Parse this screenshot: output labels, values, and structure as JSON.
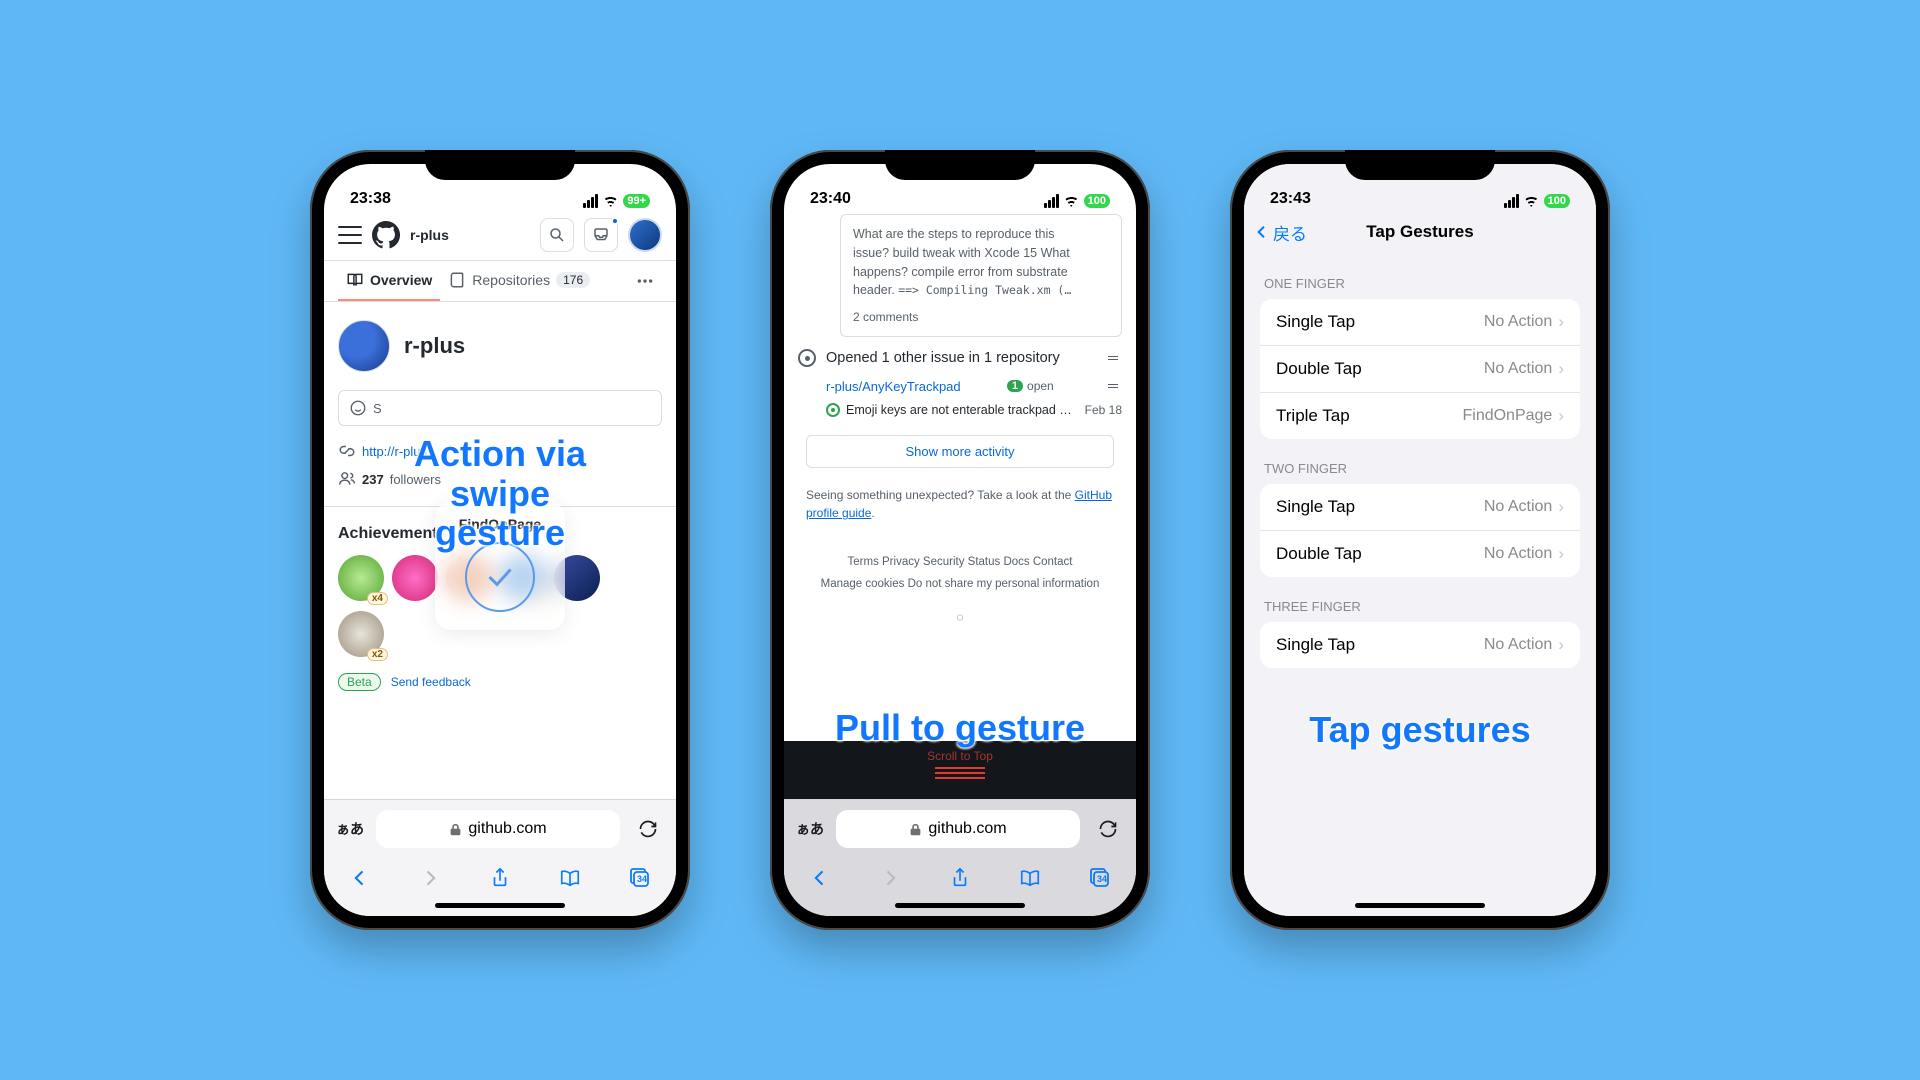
{
  "phone1": {
    "status": {
      "time": "23:38",
      "battery": "99+"
    },
    "header": {
      "username": "r-plus"
    },
    "tabs": {
      "overview": "Overview",
      "repositories": "Repositories",
      "repo_count": "176"
    },
    "profile": {
      "display_name": "r-plus",
      "status_prefix": "S",
      "link": "http://r-plus.",
      "followers_count": "237",
      "followers_label": "followers"
    },
    "hud": {
      "title": "FindOnPage"
    },
    "achievements": {
      "title": "Achievements",
      "x4a": "x4",
      "x4b": "x4",
      "x2": "x2",
      "beta": "Beta",
      "feedback": "Send feedback"
    },
    "safari": {
      "domain": "github.com",
      "aa": "ぁあ",
      "tabs": "34"
    },
    "caption": "Action via\nswipe gesture"
  },
  "phone2": {
    "status": {
      "time": "23:40",
      "battery": "100"
    },
    "card": {
      "body_line1": "What are the steps to reproduce this",
      "body_line2": "issue? build tweak with Xcode 15 What",
      "body_line3": "happens? compile error from substrate",
      "body_line4": "header. ",
      "code": "==>  Compiling Tweak.xm (…",
      "comments": "2 comments"
    },
    "event": {
      "title": "Opened 1 other issue in 1 repository",
      "repo": "r-plus/AnyKeyTrackpad",
      "open_n": "1",
      "open_label": "open",
      "issue_title": "Emoji keys are not enterable trackpad …",
      "issue_date": "Feb 18"
    },
    "show_more": "Show more activity",
    "unexpected_pre": "Seeing something unexpected? Take a look at the ",
    "unexpected_link": "GitHub profile guide",
    "footer": {
      "row1": "Terms   Privacy   Security   Status   Docs   Contact",
      "row2": "Manage cookies    Do not share my personal information"
    },
    "pull_label": "Scroll to Top",
    "safari": {
      "domain": "github.com",
      "aa": "ぁあ",
      "tabs": "34"
    },
    "caption": "Pull to gesture"
  },
  "phone3": {
    "status": {
      "time": "23:43",
      "battery": "100"
    },
    "nav": {
      "back": "戻る",
      "title": "Tap Gestures"
    },
    "sections": {
      "one": "ONE FINGER",
      "two": "TWO FINGER",
      "three": "THREE FINGER"
    },
    "rows": {
      "single": "Single Tap",
      "double": "Double Tap",
      "triple": "Triple Tap",
      "no_action": "No Action",
      "find": "FindOnPage"
    },
    "caption": "Tap gestures"
  }
}
